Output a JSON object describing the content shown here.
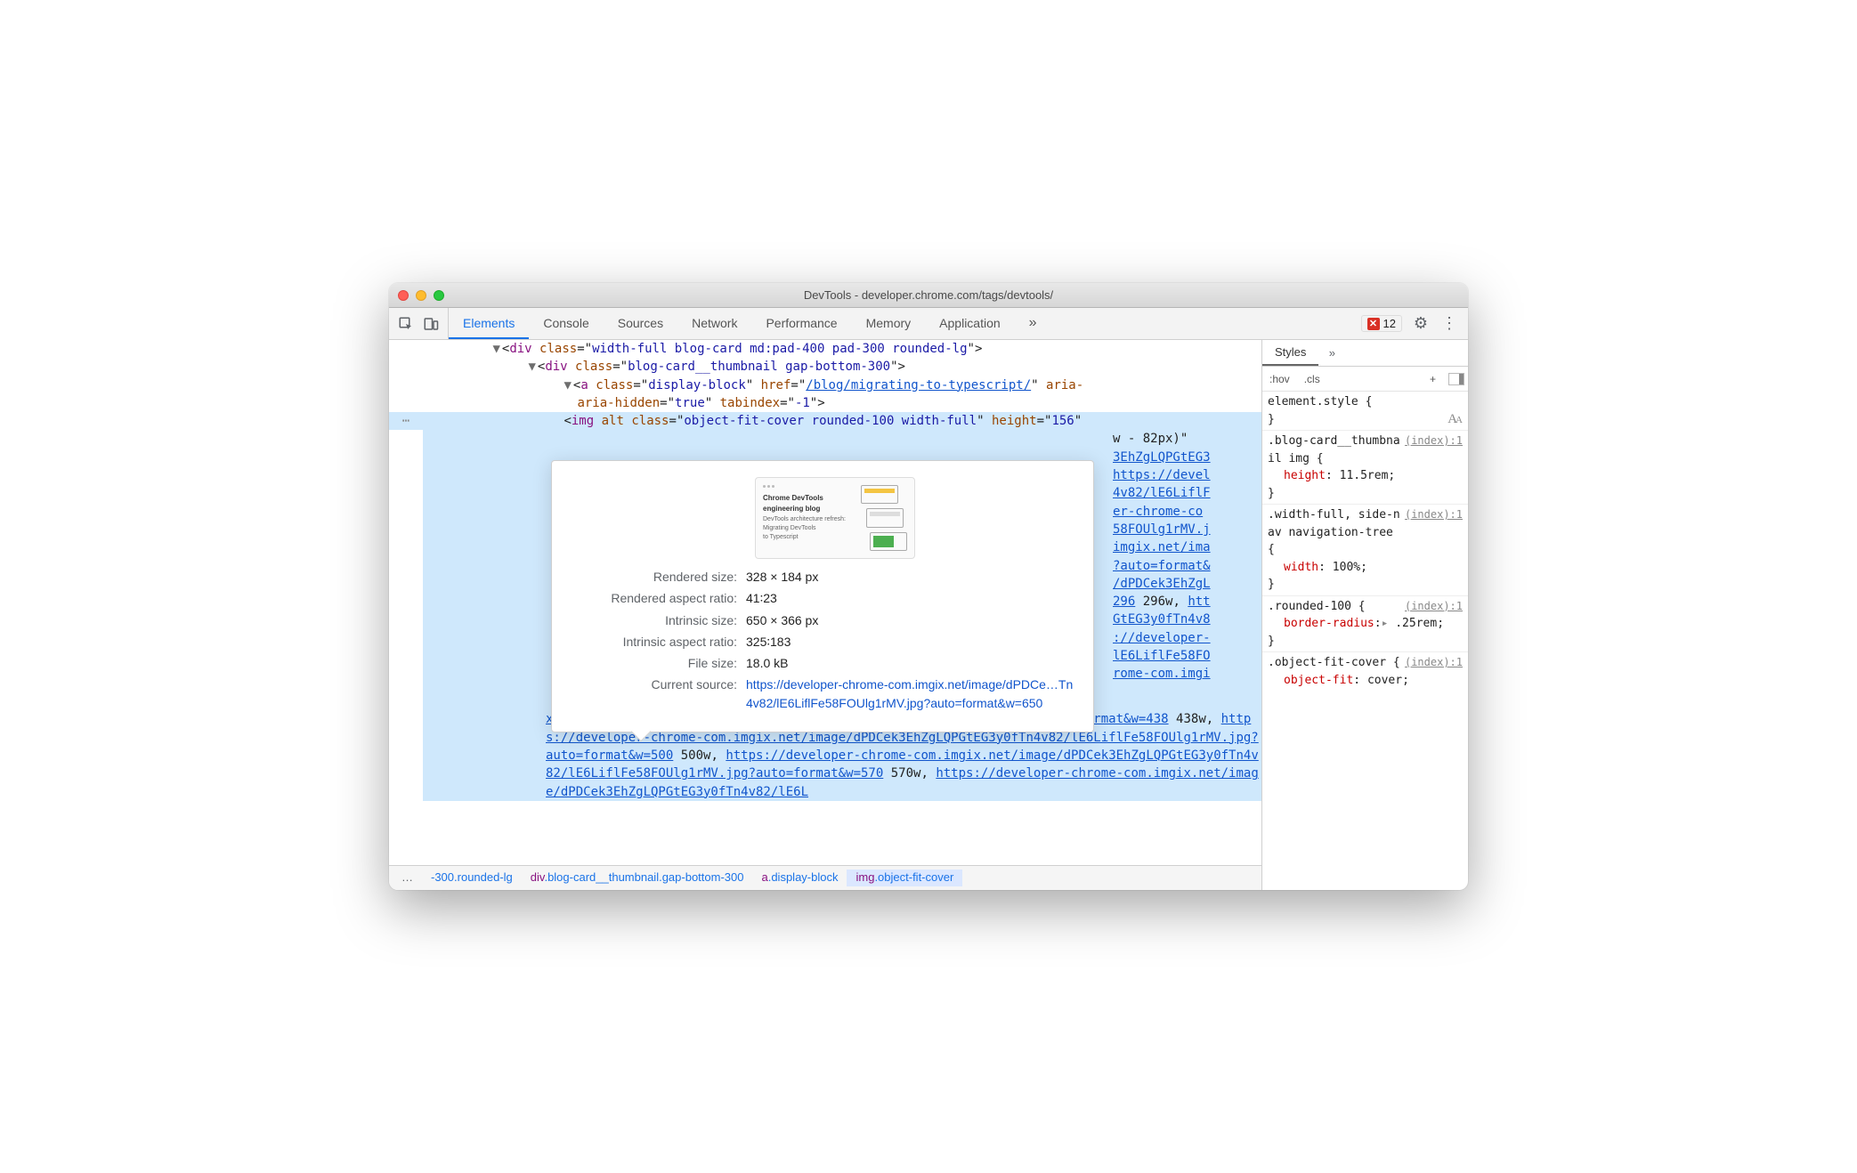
{
  "window": {
    "title": "DevTools - developer.chrome.com/tags/devtools/"
  },
  "toolbar": {
    "tabs": [
      "Elements",
      "Console",
      "Sources",
      "Network",
      "Performance",
      "Memory",
      "Application"
    ],
    "activeTab": "Elements",
    "errorCount": "12"
  },
  "dom": {
    "line1": {
      "tag": "div",
      "classVal": "width-full blog-card md:pad-400 pad-300 rounded-lg"
    },
    "line2": {
      "tag": "div",
      "classVal": "blog-card__thumbnail gap-bottom-300"
    },
    "line3": {
      "tag": "a",
      "classVal": "display-block",
      "href": "/blog/migrating-to-typescript/",
      "ariaSeg": "aria-hidden",
      "ariaVal": "true",
      "tabindexVal": "-1"
    },
    "img": {
      "tag": "img",
      "classVal": "object-fit-cover rounded-100 width-full",
      "heightVal": "156",
      "trailing1": "w - 82px)\"",
      "links": [
        "3EhZgLQPGtEG3",
        "https://devel",
        "4v82/lE6LiflF",
        "er-chrome-co",
        "58FOUlg1rMV.j",
        "imgix.net/ima",
        "?auto=format&",
        "/dPDCek3EhZgL",
        "296",
        "htt",
        "GtEG3y0fTn4v8",
        "://developer-",
        "lE6LiflFe58FO",
        "rome-com.imgi"
      ],
      "srcsetText": "x.net/image/dPDCek3EhZgLQPGtEG3y0fTn4v82/lE6LiflFe58FOUlg1rMV.jpg?auto=format&w=438",
      "srcsetW1": "438w,",
      "srcsetLink2": "https://developer-chrome-com.imgix.net/image/dPDCek3EhZgLQPGtEG3y0fTn4v82/lE6LiflFe58FOUlg1rMV.jpg?auto=format&w=500",
      "srcsetW2": "500w,",
      "srcsetLink3": "https://developer-chrome-com.imgix.net/image/dPDCek3EhZgLQPGtEG3y0fTn4v82/lE6LiflFe58FOUlg1rMV.jpg?auto=format&w=570",
      "srcsetW3": "570w,",
      "srcsetLink4": "https://developer-chrome-com.imgix.net/image/dPDCek3EhZgLQPGtEG3y0fTn4v82/lE6L",
      "after296": "296w,"
    }
  },
  "hover": {
    "thumbTitle": "Chrome DevTools engineering blog",
    "thumbLine1": "DevTools architecture refresh:",
    "thumbLine2": "Migrating DevTools",
    "thumbLine3": "to Typescript",
    "rows": {
      "renderedSizeK": "Rendered size:",
      "renderedSizeV": "328 × 184 px",
      "renderedAspectK": "Rendered aspect ratio:",
      "renderedAspectV": "41∶23",
      "intrinsicSizeK": "Intrinsic size:",
      "intrinsicSizeV": "650 × 366 px",
      "intrinsicAspectK": "Intrinsic aspect ratio:",
      "intrinsicAspectV": "325∶183",
      "fileSizeK": "File size:",
      "fileSizeV": "18.0 kB",
      "currentSourceK": "Current source:",
      "currentSourceV": "https://developer-chrome-com.imgix.net/image/dPDCe…Tn4v82/lE6LiflFe58FOUlg1rMV.jpg?auto=format&w=650"
    }
  },
  "breadcrumb": {
    "ell": "…",
    "c1": "-300.rounded-lg",
    "c2pre": "div",
    "c2suf": ".blog-card__thumbnail.gap-bottom-300",
    "c3pre": "a",
    "c3suf": ".display-block",
    "c4pre": "img",
    "c4suf": ".object-fit-cover"
  },
  "styles": {
    "tab": "Styles",
    "hov": ":hov",
    "cls": ".cls",
    "plus": "+",
    "elementStyle": {
      "sel": "element.style {",
      "close": "}"
    },
    "rule1": {
      "src": "(index):1",
      "sel": ".blog-card__thumbnail img {",
      "prop": "height",
      "val": "11.5rem;",
      "close": "}"
    },
    "rule2": {
      "src": "(index):1",
      "sel": ".width-full, side-nav navigation-tree {",
      "prop": "width",
      "val": "100%;",
      "close": "}"
    },
    "rule3": {
      "src": "(index):1",
      "sel": ".rounded-100 {",
      "prop": "border-radius",
      "val": ".25rem;",
      "close": "}"
    },
    "rule4": {
      "src": "(index):1",
      "sel": ".object-fit-cover {",
      "prop": "object-fit",
      "val": "cover;"
    }
  },
  "glyphs": {
    "moreChev": "»",
    "cog": "⚙",
    "vdots": "⋮",
    "tri": "▸"
  }
}
